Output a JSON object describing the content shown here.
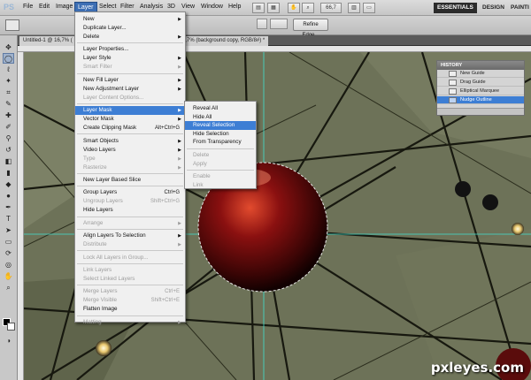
{
  "menubar": {
    "logo": "PS",
    "items": [
      "File",
      "Edit",
      "Image",
      "Layer",
      "Select",
      "Filter",
      "Analysis",
      "3D",
      "View",
      "Window",
      "Help"
    ],
    "active_index": 3,
    "zoom": "66,7",
    "workspaces": [
      "ESSENTIALS",
      "DESIGN",
      "PAINTI"
    ]
  },
  "options": {
    "refine_label": "Refine Edge..."
  },
  "doc_tabs": {
    "first": "Untitled-1 @ 16,7% (",
    "second": "6,7% (background copy, RGB/8#) *"
  },
  "layer_menu": {
    "items": [
      {
        "label": "New",
        "arrow": true
      },
      {
        "label": "Duplicate Layer..."
      },
      {
        "label": "Delete",
        "arrow": true
      },
      {
        "sep": true
      },
      {
        "label": "Layer Properties..."
      },
      {
        "label": "Layer Style",
        "arrow": true
      },
      {
        "label": "Smart Filter",
        "arrow": true,
        "disabled": true
      },
      {
        "sep": true
      },
      {
        "label": "New Fill Layer",
        "arrow": true
      },
      {
        "label": "New Adjustment Layer",
        "arrow": true
      },
      {
        "label": "Layer Content Options...",
        "disabled": true
      },
      {
        "sep": true
      },
      {
        "label": "Layer Mask",
        "arrow": true,
        "highlight": true
      },
      {
        "label": "Vector Mask",
        "arrow": true
      },
      {
        "label": "Create Clipping Mask",
        "shortcut": "Alt+Ctrl+G"
      },
      {
        "sep": true
      },
      {
        "label": "Smart Objects",
        "arrow": true
      },
      {
        "label": "Video Layers",
        "arrow": true
      },
      {
        "label": "Type",
        "arrow": true,
        "disabled": true
      },
      {
        "label": "Rasterize",
        "arrow": true,
        "disabled": true
      },
      {
        "sep": true
      },
      {
        "label": "New Layer Based Slice"
      },
      {
        "sep": true
      },
      {
        "label": "Group Layers",
        "shortcut": "Ctrl+G"
      },
      {
        "label": "Ungroup Layers",
        "shortcut": "Shift+Ctrl+G",
        "disabled": true
      },
      {
        "label": "Hide Layers"
      },
      {
        "sep": true
      },
      {
        "label": "Arrange",
        "arrow": true,
        "disabled": true
      },
      {
        "sep": true
      },
      {
        "label": "Align Layers To Selection",
        "arrow": true
      },
      {
        "label": "Distribute",
        "arrow": true,
        "disabled": true
      },
      {
        "sep": true
      },
      {
        "label": "Lock All Layers in Group...",
        "disabled": true
      },
      {
        "sep": true
      },
      {
        "label": "Link Layers",
        "disabled": true
      },
      {
        "label": "Select Linked Layers",
        "disabled": true
      },
      {
        "sep": true
      },
      {
        "label": "Merge Layers",
        "shortcut": "Ctrl+E",
        "disabled": true
      },
      {
        "label": "Merge Visible",
        "shortcut": "Shift+Ctrl+E",
        "disabled": true
      },
      {
        "label": "Flatten Image"
      },
      {
        "sep": true
      },
      {
        "label": "Matting",
        "arrow": true,
        "disabled": true
      }
    ]
  },
  "mask_submenu": {
    "items": [
      {
        "label": "Reveal All"
      },
      {
        "label": "Hide All"
      },
      {
        "label": "Reveal Selection",
        "highlight": true
      },
      {
        "label": "Hide Selection"
      },
      {
        "label": "From Transparency"
      },
      {
        "sep": true
      },
      {
        "label": "Delete",
        "disabled": true
      },
      {
        "label": "Apply",
        "disabled": true
      },
      {
        "sep": true
      },
      {
        "label": "Enable",
        "disabled": true
      },
      {
        "label": "Link",
        "disabled": true
      }
    ]
  },
  "history": {
    "title": "HISTORY",
    "rows": [
      {
        "label": "New Guide"
      },
      {
        "label": "Drag Guide"
      },
      {
        "label": "Elliptical Marquee"
      },
      {
        "label": "Nudge Outline",
        "selected": true
      }
    ]
  },
  "watermark": "pxleyes.com",
  "colors": {
    "accent": "#3d7ed4",
    "canvas_bg": "#6d7258",
    "sphere": "#8a1010"
  }
}
